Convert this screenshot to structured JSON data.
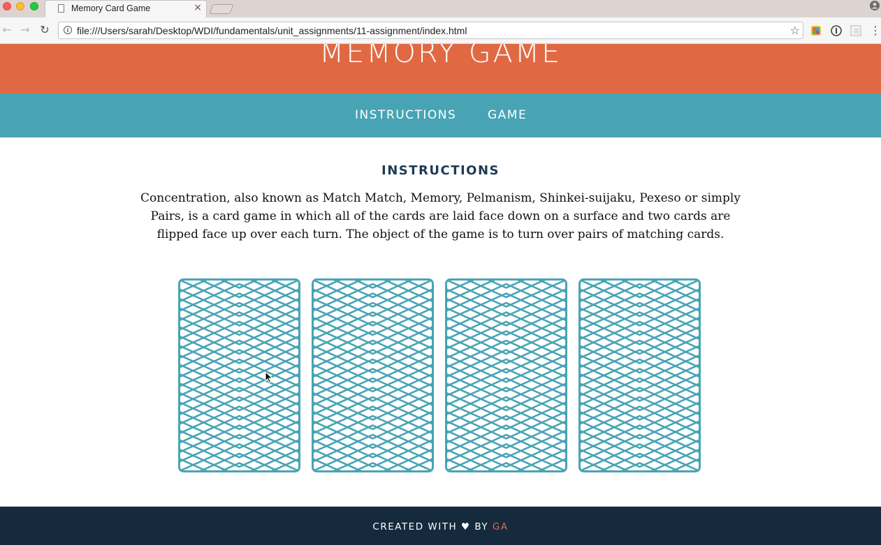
{
  "browser": {
    "tab_title": "Memory Card Game",
    "tab_close": "×",
    "url": "file:///Users/sarah/Desktop/WDI/fundamentals/unit_assignments/11-assignment/index.html",
    "back": "←",
    "forward": "→",
    "reload": "↻",
    "info": "i",
    "star": "☆",
    "menu": "⋮"
  },
  "header": {
    "title": "MEMORY GAME"
  },
  "nav": {
    "instructions": "INSTRUCTIONS",
    "game": "GAME"
  },
  "main": {
    "heading": "INSTRUCTIONS",
    "description": "Concentration, also known as Match Match, Memory, Pelmanism, Shinkei-suijaku, Pexeso or simply Pairs, is a card game in which all of the cards are laid face down on a surface and two cards are flipped face up over each turn. The object of the game is to turn over pairs of matching cards."
  },
  "cards": {
    "count": 4,
    "state": "face-down"
  },
  "footer": {
    "prefix": "CREATED WITH",
    "heart": "♥",
    "by": "BY",
    "brand": "GA"
  },
  "colors": {
    "header_bg": "#e06944",
    "nav_bg": "#48a4b5",
    "heading": "#1e3b54",
    "card_stroke": "#48a4b5",
    "footer_bg": "#152a3d",
    "brand": "#e06944"
  }
}
